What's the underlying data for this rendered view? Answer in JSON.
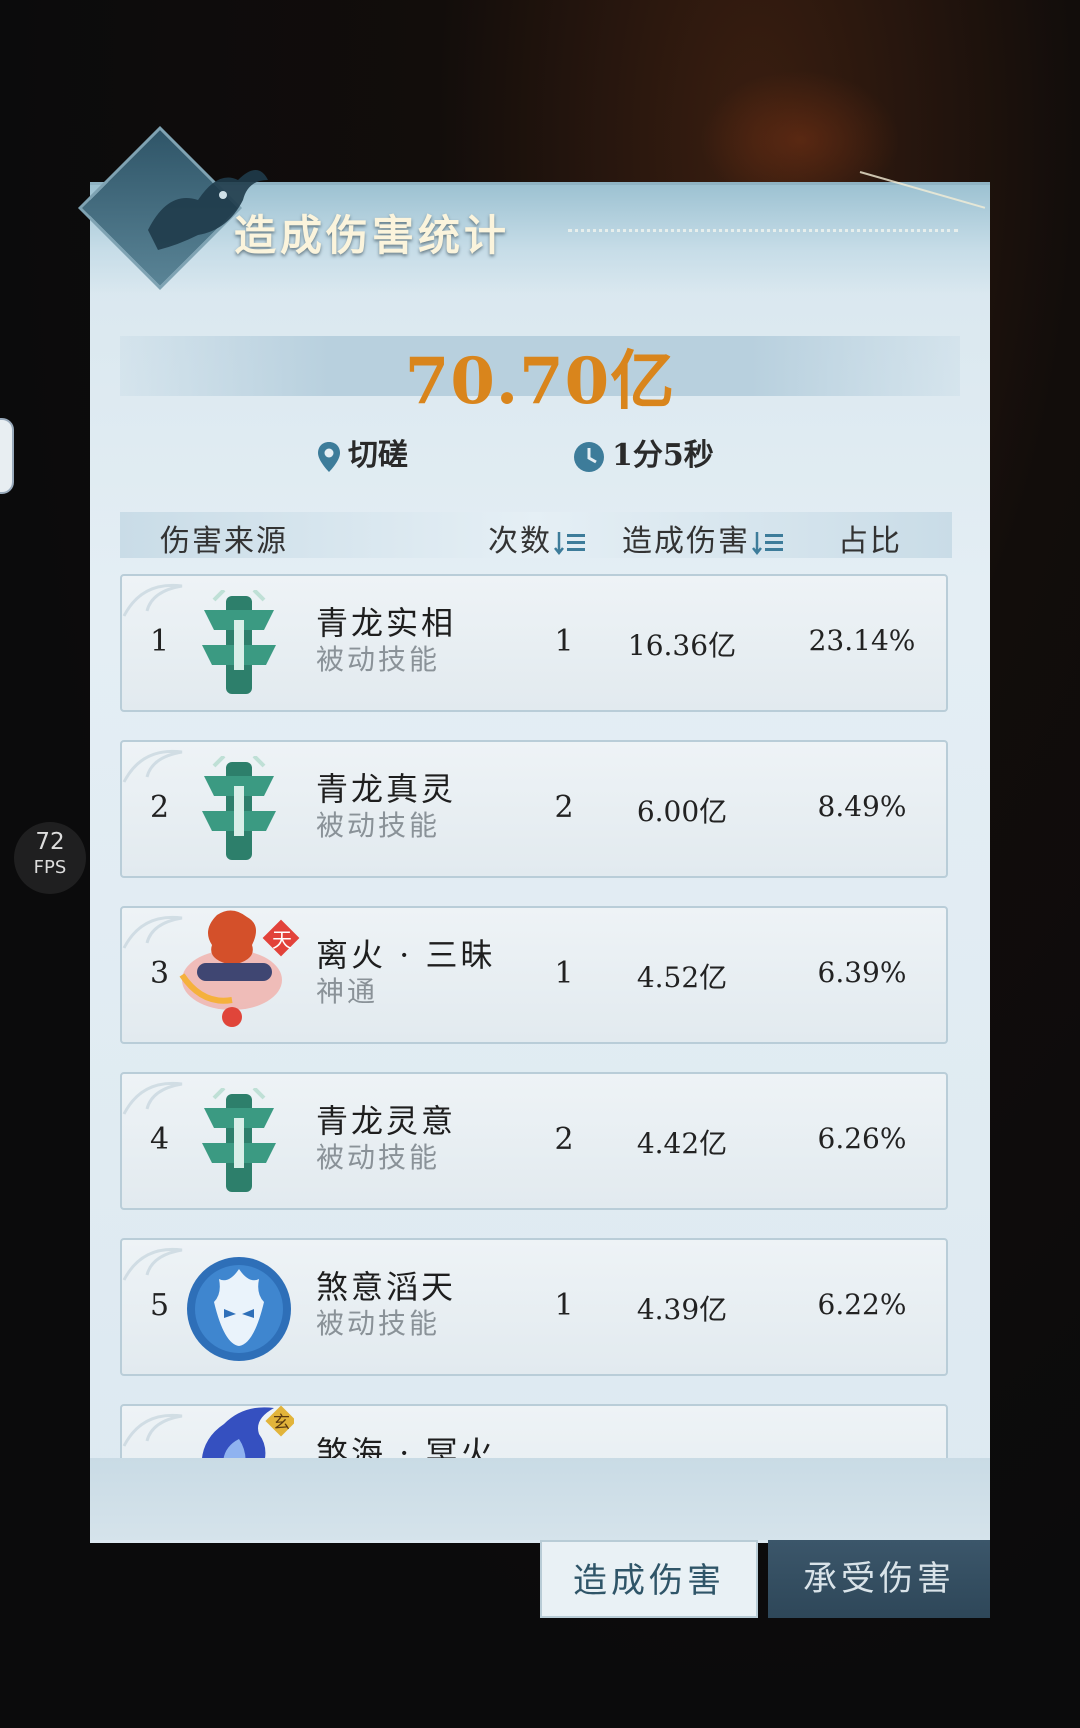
{
  "fps": {
    "value": "72",
    "unit": "FPS"
  },
  "panel": {
    "title": "造成伤害统计",
    "total": "70.70亿"
  },
  "meta": {
    "location": {
      "icon": "location-pin-icon",
      "text": "切磋"
    },
    "time": {
      "icon": "clock-icon",
      "text": "1分5秒"
    }
  },
  "table": {
    "headers": {
      "source": "伤害来源",
      "count": "次数",
      "damage": "造成伤害",
      "share": "占比"
    },
    "rows": [
      {
        "rank": "1",
        "name": "青龙实相",
        "type": "被动技能",
        "count": "1",
        "damage": "16.36亿",
        "share": "23.14%",
        "icon": "azure-dragon-icon"
      },
      {
        "rank": "2",
        "name": "青龙真灵",
        "type": "被动技能",
        "count": "2",
        "damage": "6.00亿",
        "share": "8.49%",
        "icon": "azure-dragon-icon"
      },
      {
        "rank": "3",
        "name": "离火 · 三昧",
        "type": "神通",
        "count": "1",
        "damage": "4.52亿",
        "share": "6.39%",
        "icon": "fire-scroll-icon",
        "badge": "天"
      },
      {
        "rank": "4",
        "name": "青龙灵意",
        "type": "被动技能",
        "count": "2",
        "damage": "4.42亿",
        "share": "6.26%",
        "icon": "azure-dragon-icon"
      },
      {
        "rank": "5",
        "name": "煞意滔天",
        "type": "被动技能",
        "count": "1",
        "damage": "4.39亿",
        "share": "6.22%",
        "icon": "demon-mask-icon"
      },
      {
        "rank": "",
        "name": "煞海 · 冥火",
        "type": "",
        "count": "",
        "damage": "",
        "share": "",
        "icon": "blue-flame-icon",
        "badge": "玄"
      }
    ]
  },
  "tabs": {
    "dealt": "造成伤害",
    "taken": "承受伤害"
  },
  "colors": {
    "accent": "#d9851c",
    "panel": "#dde9f1",
    "dark_tab": "#2e4759"
  }
}
